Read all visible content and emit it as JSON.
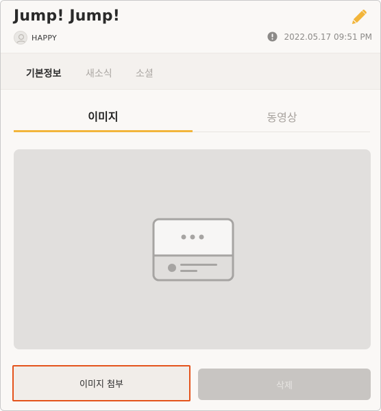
{
  "header": {
    "title": "Jump! Jump!",
    "username": "HAPPY",
    "timestamp": "2022.05.17 09:51 PM",
    "icons": {
      "edit": "pencil-icon",
      "avatar": "user-avatar",
      "alert": "alert-circle-icon"
    },
    "accent_color": "#f2b53a"
  },
  "subnav": {
    "items": [
      {
        "label": "기본정보",
        "active": true
      },
      {
        "label": "새소식",
        "active": false
      },
      {
        "label": "소셜",
        "active": false
      }
    ]
  },
  "media_tabs": [
    {
      "label": "이미지",
      "active": true
    },
    {
      "label": "동영상",
      "active": false
    }
  ],
  "preview": {
    "icon": "image-placeholder-icon"
  },
  "actions": {
    "attach_label": "이미지 첨부",
    "delete_label": "삭제",
    "highlight_color": "#e4521b"
  }
}
